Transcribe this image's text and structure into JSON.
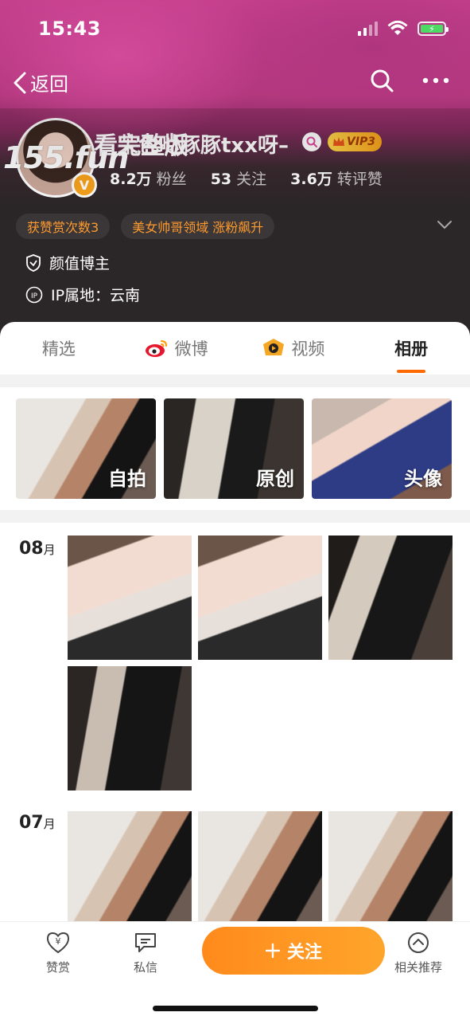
{
  "status_bar": {
    "time": "15:43"
  },
  "nav": {
    "back_label": "返回"
  },
  "watermark": {
    "site": "155.fun",
    "text": "看完整版"
  },
  "profile": {
    "username": "茉色哒豚豚txx呀–",
    "vip_label": "VIP3",
    "verified_letter": "V",
    "stats": [
      {
        "value": "8.2万",
        "label": "粉丝"
      },
      {
        "value": "53",
        "label": "关注"
      },
      {
        "value": "3.6万",
        "label": "转评赞"
      }
    ],
    "tags": [
      "获赞赏次数3",
      "美女帅哥领域 涨粉飙升"
    ],
    "role": "颜值博主",
    "ip_location": "IP属地：云南"
  },
  "tabs": [
    {
      "label": "精选",
      "active": false
    },
    {
      "label": "微博",
      "active": false
    },
    {
      "label": "视频",
      "active": false
    },
    {
      "label": "相册",
      "active": true
    }
  ],
  "albums": [
    {
      "label": "自拍"
    },
    {
      "label": "原创"
    },
    {
      "label": "头像"
    }
  ],
  "months": [
    {
      "number": "08",
      "unit": "月",
      "photo_count": 4
    },
    {
      "number": "07",
      "unit": "月",
      "photo_count": 3
    }
  ],
  "bottom_bar": {
    "reward_label": "赞赏",
    "message_label": "私信",
    "follow_label": "关注",
    "related_label": "相关推荐"
  },
  "colors": {
    "accent": "#ff8a1c",
    "tag_text": "#ff9a2e",
    "header_dark": "#2b2628",
    "header_pink": "#c43f8c"
  },
  "icons": [
    "back-chevron-icon",
    "search-icon",
    "more-icon",
    "verified-icon",
    "vip-crown-icon",
    "shield-icon",
    "ip-icon",
    "weibo-icon",
    "video-icon",
    "reward-icon",
    "message-icon",
    "plus-icon",
    "related-icon",
    "chevron-down-icon"
  ]
}
